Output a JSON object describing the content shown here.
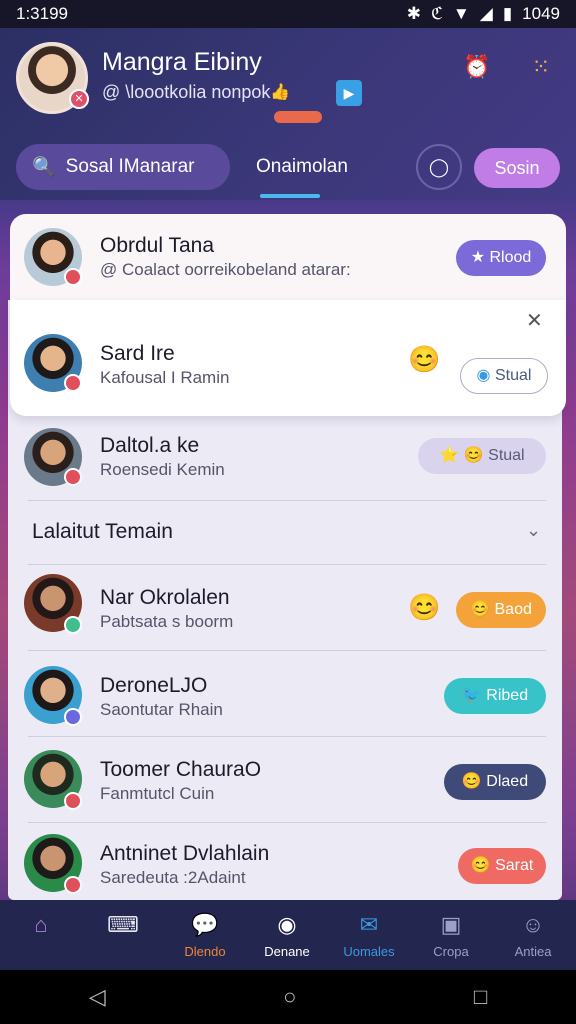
{
  "status": {
    "time": "1:3199",
    "icons": [
      "bluetooth-icon",
      "nfc-icon",
      "wifi-icon",
      "signal-icon"
    ],
    "battery": "1049"
  },
  "header": {
    "user_name": "Mangra Eibiny",
    "user_sub": "@ \\loootkolia nonpok",
    "sub_emoji": "👍",
    "search_label": "Sosal IManarar",
    "tab_online": "Onaimolan",
    "action_label": "Sosin"
  },
  "friends": [
    {
      "name": "Obrdul Tana",
      "sub": "@ Coalact oorreikobeland atarar:",
      "sub_icon": "⓪",
      "button": "Rlood",
      "button_icon": "★",
      "button_color": "#7b6ad8"
    },
    {
      "name": "Sard Ire",
      "sub": "Kafousal I Ramin",
      "emoji": "😊",
      "button": "Stual",
      "button_icon": "◉",
      "button_style": "outline"
    },
    {
      "name": "Daltol.a ke",
      "sub": "Roensedi Kemin",
      "emoji": "⭐",
      "button": "Stual",
      "button_icon": "😊",
      "button_color": "#d9d3ee"
    }
  ],
  "section": {
    "title": "Lalaitut Temain"
  },
  "latest": [
    {
      "name": "Nar Okrolalen",
      "sub": "Pabtsata s boorm",
      "emoji": "😊",
      "button": "Baod",
      "button_icon": "😊",
      "button_color": "#f3a33a"
    },
    {
      "name": "DeroneLJO",
      "sub": "Saontutar Rhain",
      "button": "Ribed",
      "button_icon": "🐦",
      "button_color": "#38c3c8"
    },
    {
      "name": "Toomer ChauraO",
      "sub": "Fanmtutcl Cuin",
      "button": "Dlaed",
      "button_icon": "😊",
      "button_color": "#3f4a78"
    },
    {
      "name": "Antninet Dvlahlain",
      "sub": "Saredeuta :2Adaint",
      "button": "Sarat",
      "button_icon": "😊",
      "button_color": "#ee6a63"
    }
  ],
  "bottom_nav": [
    {
      "label": "",
      "icon": "home-icon"
    },
    {
      "label": "",
      "icon": "keyboard-icon"
    },
    {
      "label": "Dlendo",
      "icon": "chat-icon"
    },
    {
      "label": "Denane",
      "icon": "camera-icon"
    },
    {
      "label": "Uomales",
      "icon": "mail-icon"
    },
    {
      "label": "Cropa",
      "icon": "image-icon"
    },
    {
      "label": "Antiea",
      "icon": "person-icon"
    }
  ]
}
